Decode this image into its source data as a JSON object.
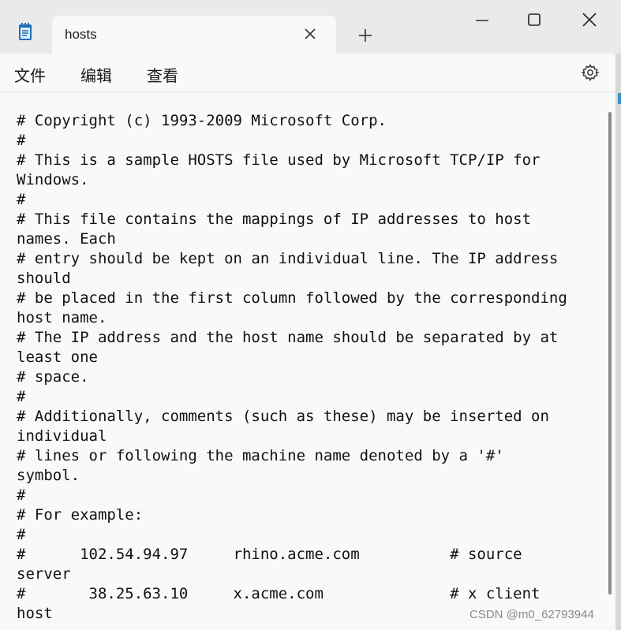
{
  "window": {
    "tab_title": "hosts",
    "icons": [
      "notepad-icon",
      "close-tab-icon",
      "new-tab-icon",
      "minimize-icon",
      "maximize-icon",
      "close-window-icon"
    ]
  },
  "menu": {
    "items": [
      "文件",
      "编辑",
      "查看"
    ],
    "settings_icon": "gear-icon"
  },
  "editor": {
    "lines": [
      "# Copyright (c) 1993-2009 Microsoft Corp.",
      "#",
      "# This is a sample HOSTS file used by Microsoft TCP/IP for",
      "Windows.",
      "#",
      "# This file contains the mappings of IP addresses to host",
      "names. Each",
      "# entry should be kept on an individual line. The IP address",
      "should",
      "# be placed in the first column followed by the corresponding",
      "host name.",
      "# The IP address and the host name should be separated by at",
      "least one",
      "# space.",
      "#",
      "# Additionally, comments (such as these) may be inserted on",
      "individual",
      "# lines or following the machine name denoted by a '#'",
      "symbol.",
      "#",
      "# For example:",
      "#",
      "#      102.54.94.97     rhino.acme.com          # source",
      "server",
      "#       38.25.63.10     x.acme.com              # x client",
      "host"
    ]
  },
  "watermark": "CSDN @m0_62793944"
}
